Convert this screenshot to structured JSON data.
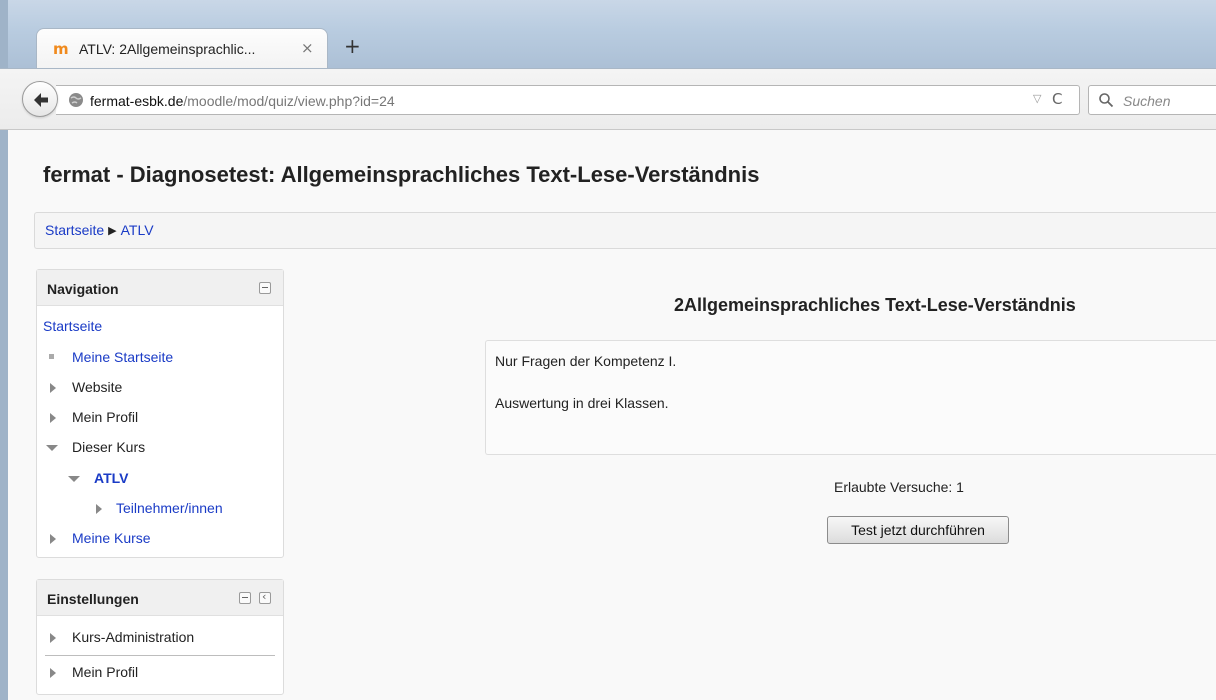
{
  "browser": {
    "tab": {
      "title": "ATLV: 2Allgemeinsprachlic...",
      "close_glyph": "×",
      "favicon": "moodle-favicon"
    },
    "new_tab_glyph": "+",
    "url": {
      "host": "fermat-esbk.de",
      "path": "/moodle/mod/quiz/view.php?id=24"
    },
    "search": {
      "placeholder": "Suchen"
    },
    "reload_glyph": "C",
    "dropdown_glyph": "▽"
  },
  "page": {
    "title": "fermat - Diagnosetest: Allgemeinsprachliches Text-Lese-Verständnis",
    "breadcrumb": [
      {
        "label": "Startseite"
      },
      {
        "label": "ATLV"
      }
    ],
    "breadcrumb_separator": "▶"
  },
  "navigation_block": {
    "title": "Navigation",
    "items": [
      {
        "label": "Startseite",
        "icon": "none"
      },
      {
        "label": "Meine Startseite",
        "icon": "bullet-icon"
      },
      {
        "label": "Website",
        "icon": "collapsed-arrow-icon"
      },
      {
        "label": "Mein Profil",
        "icon": "collapsed-arrow-icon"
      },
      {
        "label": "Dieser Kurs",
        "icon": "expanded-arrow-icon"
      },
      {
        "label": "ATLV",
        "icon": "expanded-arrow-icon"
      },
      {
        "label": "Teilnehmer/innen",
        "icon": "collapsed-arrow-icon"
      },
      {
        "label": "Meine Kurse",
        "icon": "collapsed-arrow-icon"
      }
    ]
  },
  "settings_block": {
    "title": "Einstellungen",
    "items": [
      {
        "label": "Kurs-Administration",
        "icon": "collapsed-arrow-icon"
      },
      {
        "label": "Mein Profil",
        "icon": "collapsed-arrow-icon"
      }
    ],
    "dock_glyph": "‹"
  },
  "quiz": {
    "title": "2Allgemeinsprachliches Text-Lese-Verständnis",
    "intro": [
      "Nur Fragen der Kompetenz I.",
      "Auswertung in drei Klassen."
    ],
    "attempts_text": "Erlaubte Versuche: 1",
    "start_button": "Test jetzt durchführen"
  },
  "colors": {
    "link": "#1a3bc6",
    "favicon": "#f08a1d",
    "chrome": "#b9cce0"
  }
}
